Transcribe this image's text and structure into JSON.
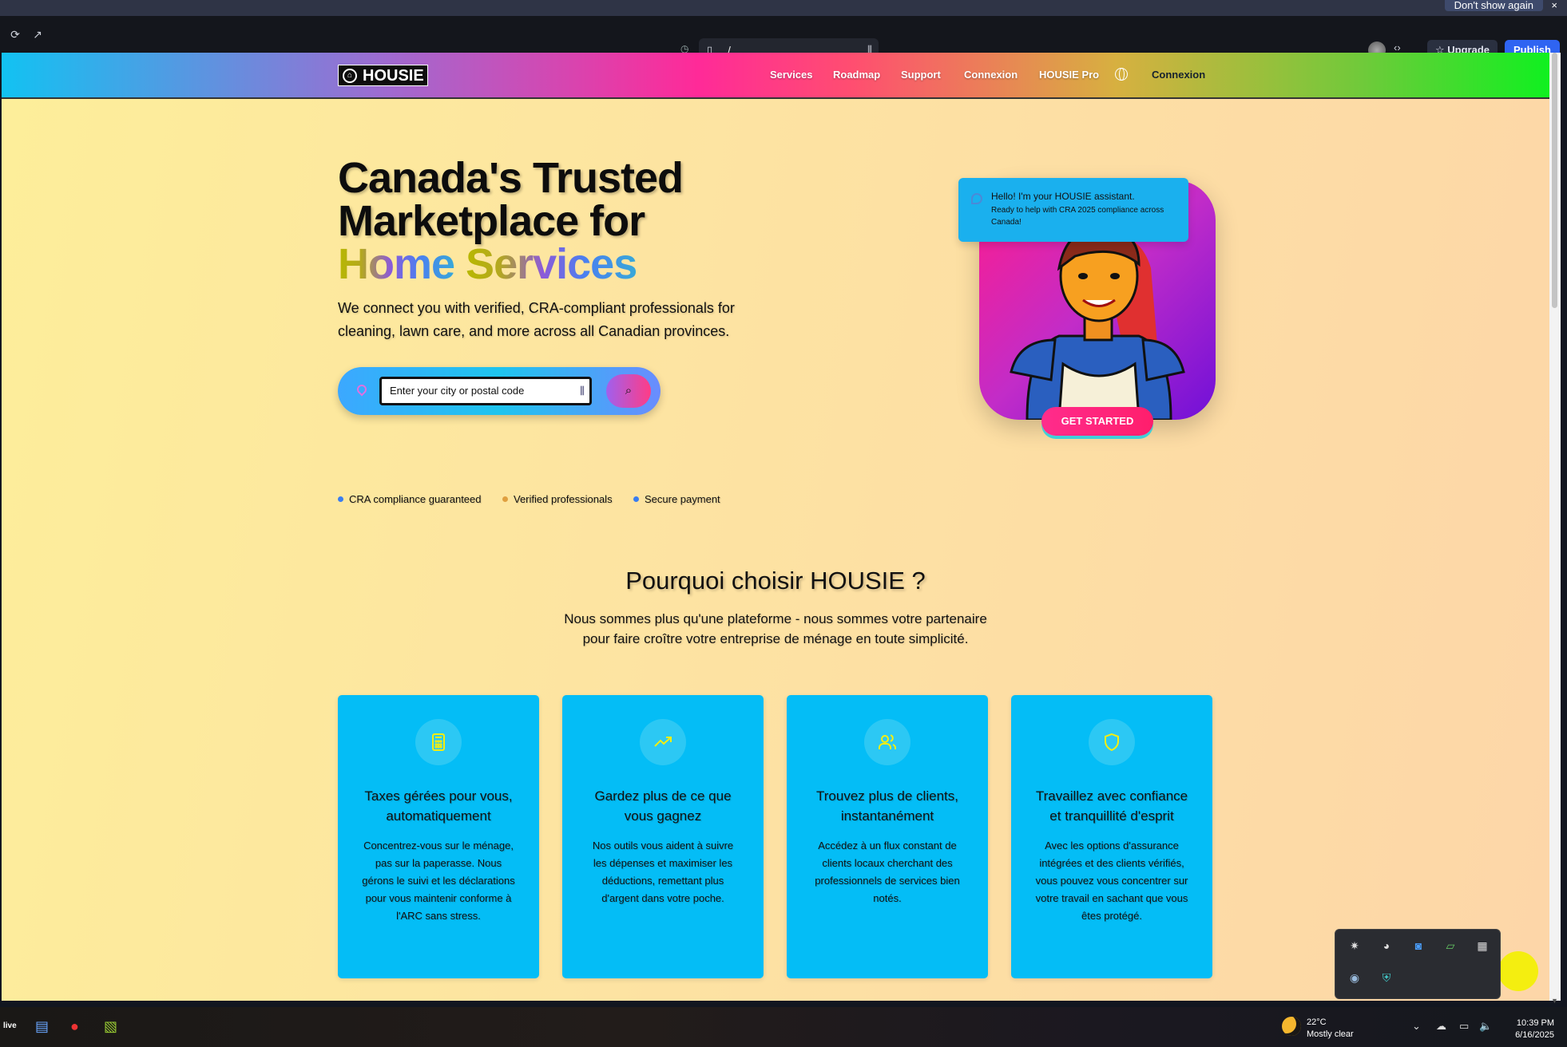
{
  "banner": {
    "dont_show": "Don't show again",
    "close": "×"
  },
  "toolbar": {
    "url": "/",
    "upgrade": "Upgrade",
    "publish": "Publish"
  },
  "nav": {
    "logo": "HOUSIE",
    "links": [
      "Services",
      "Roadmap",
      "Support",
      "Connexion",
      "HOUSIE Pro"
    ],
    "connexion": "Connexion"
  },
  "hero": {
    "title_line1": "Canada's Trusted",
    "title_line2": "Marketplace for",
    "title_line3a": "Home",
    "title_line3b": "Services",
    "subtitle": "We connect you with verified, CRA-compliant professionals for cleaning, lawn care, and more across all Canadian provinces.",
    "search_placeholder": "Enter your city or postal code",
    "features": [
      {
        "label": "CRA compliance guaranteed",
        "color": "#3a7df0"
      },
      {
        "label": "Verified professionals",
        "color": "#e0a040"
      },
      {
        "label": "Secure payment",
        "color": "#3a7df0"
      }
    ],
    "assistant_title": "Hello! I'm your HOUSIE assistant.",
    "assistant_text": "Ready to help with CRA 2025 compliance across Canada!",
    "cta": "GET STARTED"
  },
  "why": {
    "title": "Pourquoi choisir HOUSIE ?",
    "subtitle_1": "Nous sommes plus qu'une plateforme - nous sommes votre partenaire",
    "subtitle_2": "pour faire croître votre entreprise de ménage en toute simplicité."
  },
  "cards": [
    {
      "icon": "calculator-icon",
      "title": "Taxes gérées pour vous, automatiquement",
      "text": "Concentrez-vous sur le ménage, pas sur la paperasse. Nous gérons le suivi et les déclarations pour vous maintenir conforme à l'ARC sans stress."
    },
    {
      "icon": "trending-up-icon",
      "title": "Gardez plus de ce que vous gagnez",
      "text": "Nos outils vous aident à suivre les dépenses et maximiser les déductions, remettant plus d'argent dans votre poche."
    },
    {
      "icon": "users-icon",
      "title": "Trouvez plus de clients, instantanément",
      "text": "Accédez à un flux constant de clients locaux cherchant des professionnels de services bien notés."
    },
    {
      "icon": "shield-icon",
      "title": "Travaillez avec confiance et tranquillité d'esprit",
      "text": "Avec les options d'assurance intégrées et des clients vérifiés, vous pouvez vous concentrer sur votre travail en sachant que vous êtes protégé."
    }
  ],
  "taskbar": {
    "live": "live",
    "temp": "22°C",
    "weather": "Mostly clear",
    "time": "10:39 PM",
    "date": "6/16/2025"
  }
}
